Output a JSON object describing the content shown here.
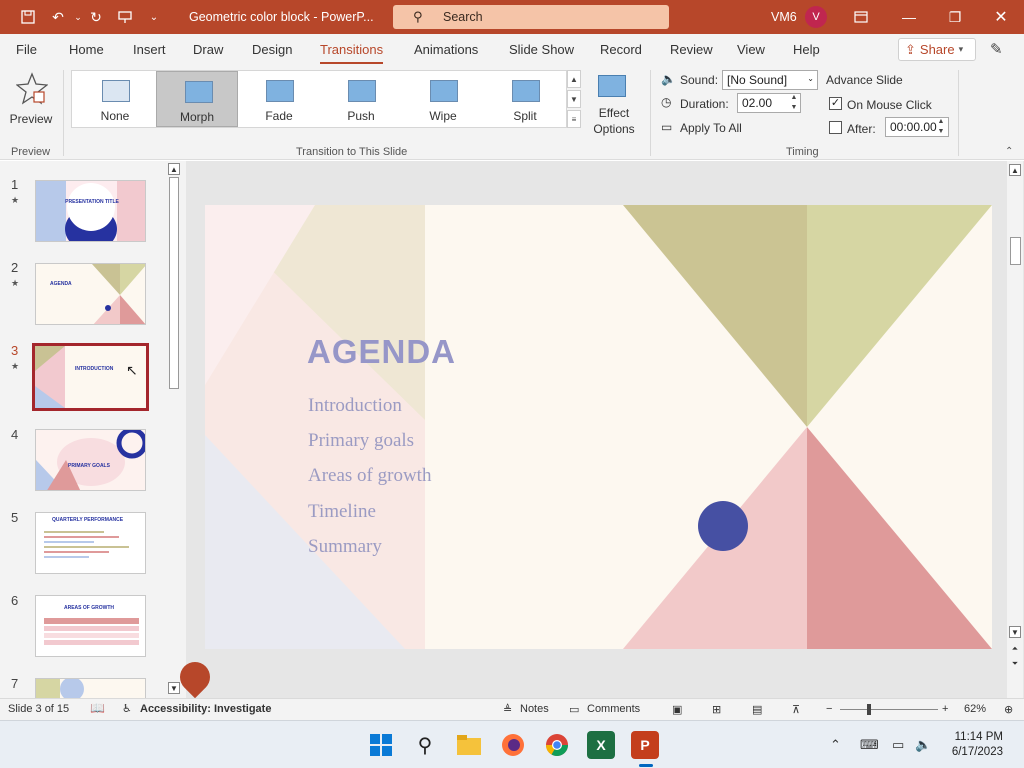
{
  "titlebar": {
    "doc_title": "Geometric color block  -  PowerP...",
    "search_label": "Search",
    "user_name": "VM6",
    "avatar_initial": "V",
    "accent": "#b7472a"
  },
  "menu": {
    "tabs": [
      "File",
      "Home",
      "Insert",
      "Draw",
      "Design",
      "Transitions",
      "Animations",
      "Slide Show",
      "Record",
      "Review",
      "View",
      "Help"
    ],
    "active_tab": "Transitions",
    "share_label": "Share"
  },
  "ribbon": {
    "preview_label": "Preview",
    "preview_group": "Preview",
    "transitions": [
      "None",
      "Morph",
      "Fade",
      "Push",
      "Wipe",
      "Split"
    ],
    "selected_transition": "Morph",
    "effect_options_label": "Effect Options",
    "transition_group": "Transition to This Slide",
    "sound_label": "Sound:",
    "sound_value": "[No Sound]",
    "duration_label": "Duration:",
    "duration_value": "02.00",
    "apply_all_label": "Apply To All",
    "advance_label": "Advance Slide",
    "on_mouse_click_label": "On Mouse Click",
    "on_mouse_click_checked": true,
    "after_label": "After:",
    "after_value": "00:00.00",
    "after_checked": false,
    "timing_group": "Timing"
  },
  "thumbnails": {
    "slides": [
      {
        "num": "1",
        "star": "★",
        "title": "PRESENTATION TITLE"
      },
      {
        "num": "2",
        "star": "★",
        "title": "AGENDA"
      },
      {
        "num": "3",
        "star": "★",
        "title": "INTRODUCTION"
      },
      {
        "num": "4",
        "star": "",
        "title": "PRIMARY GOALS"
      },
      {
        "num": "5",
        "star": "",
        "title": "QUARTERLY PERFORMANCE"
      },
      {
        "num": "6",
        "star": "",
        "title": "AREAS OF GROWTH"
      },
      {
        "num": "7",
        "star": "",
        "title": ""
      }
    ],
    "selected_index": 2
  },
  "slide": {
    "title": "AGENDA",
    "items": [
      "Introduction",
      "Primary goals",
      "Areas of growth",
      "Timeline",
      "Summary"
    ]
  },
  "statusbar": {
    "slide_info": "Slide 3 of 15",
    "accessibility": "Accessibility: Investigate",
    "notes_label": "Notes",
    "comments_label": "Comments",
    "zoom": "62%"
  },
  "taskbar": {
    "time": "11:14 PM",
    "date": "6/17/2023"
  }
}
